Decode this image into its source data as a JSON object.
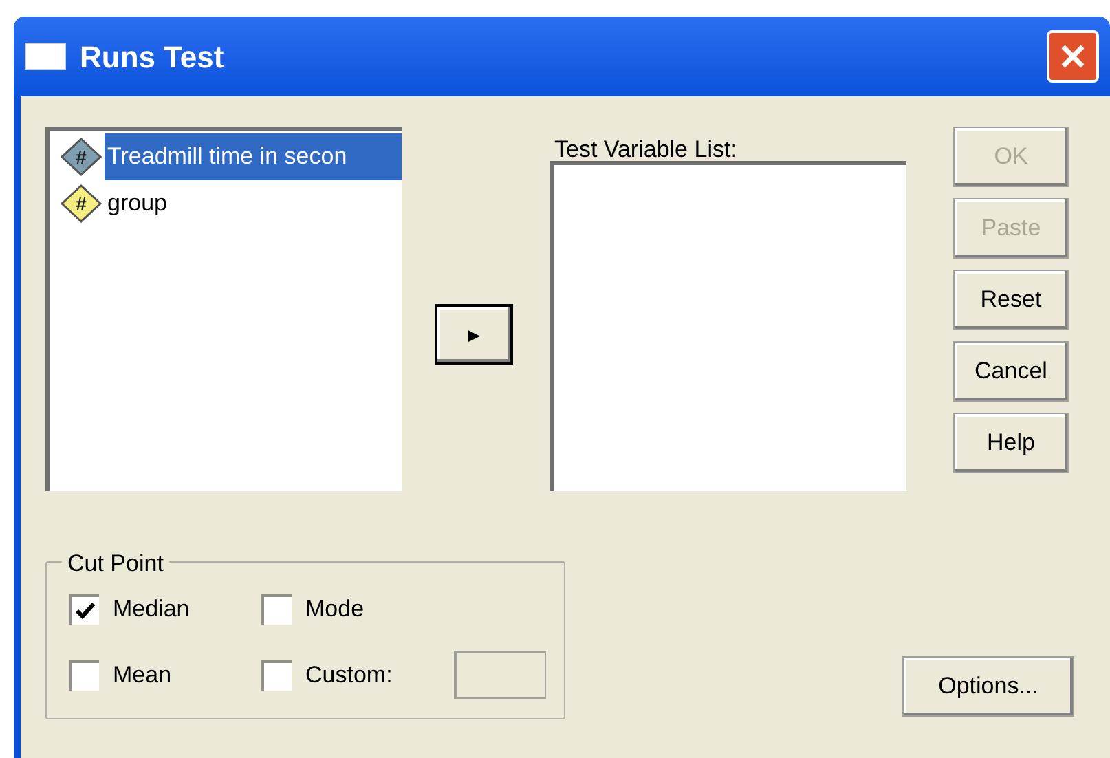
{
  "window": {
    "title": "Runs Test"
  },
  "source_list": {
    "items": [
      {
        "label": "Treadmill time in secon",
        "icon": "#",
        "kind": "scale",
        "selected": true
      },
      {
        "label": "group",
        "icon": "#",
        "kind": "nominal",
        "selected": false
      }
    ]
  },
  "move_button": {
    "label": "▸"
  },
  "target_list": {
    "label": "Test Variable List:"
  },
  "buttons": [
    {
      "label": "OK",
      "disabled": true
    },
    {
      "label": "Paste",
      "disabled": true
    },
    {
      "label": "Reset",
      "disabled": false
    },
    {
      "label": "Cancel",
      "disabled": false
    },
    {
      "label": "Help",
      "disabled": false
    }
  ],
  "cut_point": {
    "title": "Cut Point",
    "options": [
      {
        "label": "Median",
        "checked": true
      },
      {
        "label": "Mode",
        "checked": false
      },
      {
        "label": "Mean",
        "checked": false
      },
      {
        "label": "Custom:",
        "checked": false
      }
    ],
    "custom_field": {
      "disabled": true
    }
  },
  "options_button": {
    "label": "Options..."
  }
}
